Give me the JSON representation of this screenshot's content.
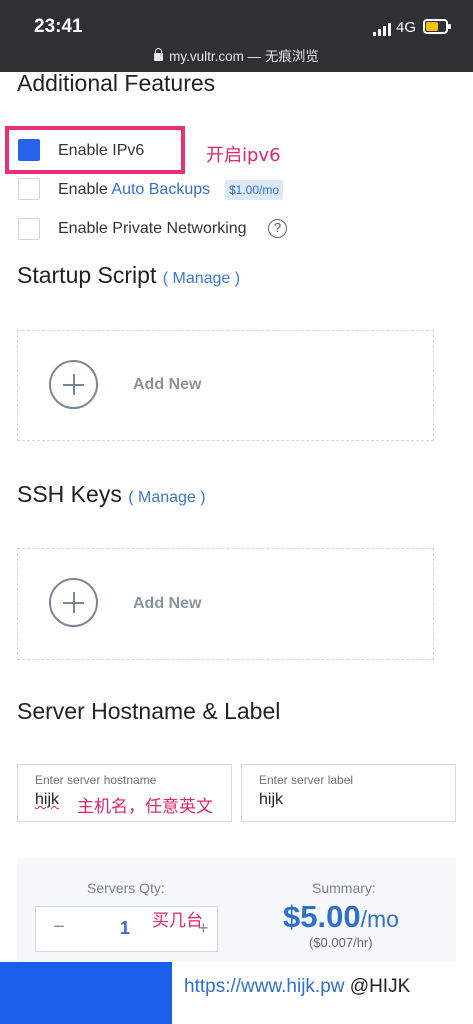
{
  "status_bar": {
    "time": "23:41",
    "network": "4G",
    "url": "my.vultr.com — 无痕浏览"
  },
  "additional_features": {
    "title": "Additional Features",
    "ipv6_label": "Enable IPv6",
    "auto_backups_prefix": "Enable",
    "auto_backups_link": "Auto Backups",
    "auto_backups_price": "$1.00/mo",
    "private_networking_label": "Enable Private Networking",
    "help_glyph": "?"
  },
  "annotations": {
    "ipv6": "开启ipv6",
    "hostname": "主机名，任意英文",
    "qty": "买几台"
  },
  "startup_script": {
    "title": "Startup Script",
    "manage": "( Manage )",
    "add_new": "Add New"
  },
  "ssh_keys": {
    "title": "SSH Keys",
    "manage": "( Manage )",
    "add_new": "Add New"
  },
  "hostname_section": {
    "title": "Server Hostname & Label",
    "hostname_label": "Enter server hostname",
    "hostname_value": "hijk",
    "label_label": "Enter server label",
    "label_value": "hijk"
  },
  "summary": {
    "qty_label": "Servers Qty:",
    "minus": "−",
    "qty_value": "1",
    "plus": "+",
    "summary_label": "Summary:",
    "price": "$5.00",
    "price_unit": "/mo",
    "hourly": "($0.007/hr)"
  },
  "watermark": {
    "url": "https://www.hijk.pw",
    "handle": "@HIJK"
  },
  "colors": {
    "accent": "#2f6fd0",
    "checkbox_checked": "#2563eb",
    "annotation": "#e0246e",
    "bottom_bar": "#1b5ee8"
  }
}
